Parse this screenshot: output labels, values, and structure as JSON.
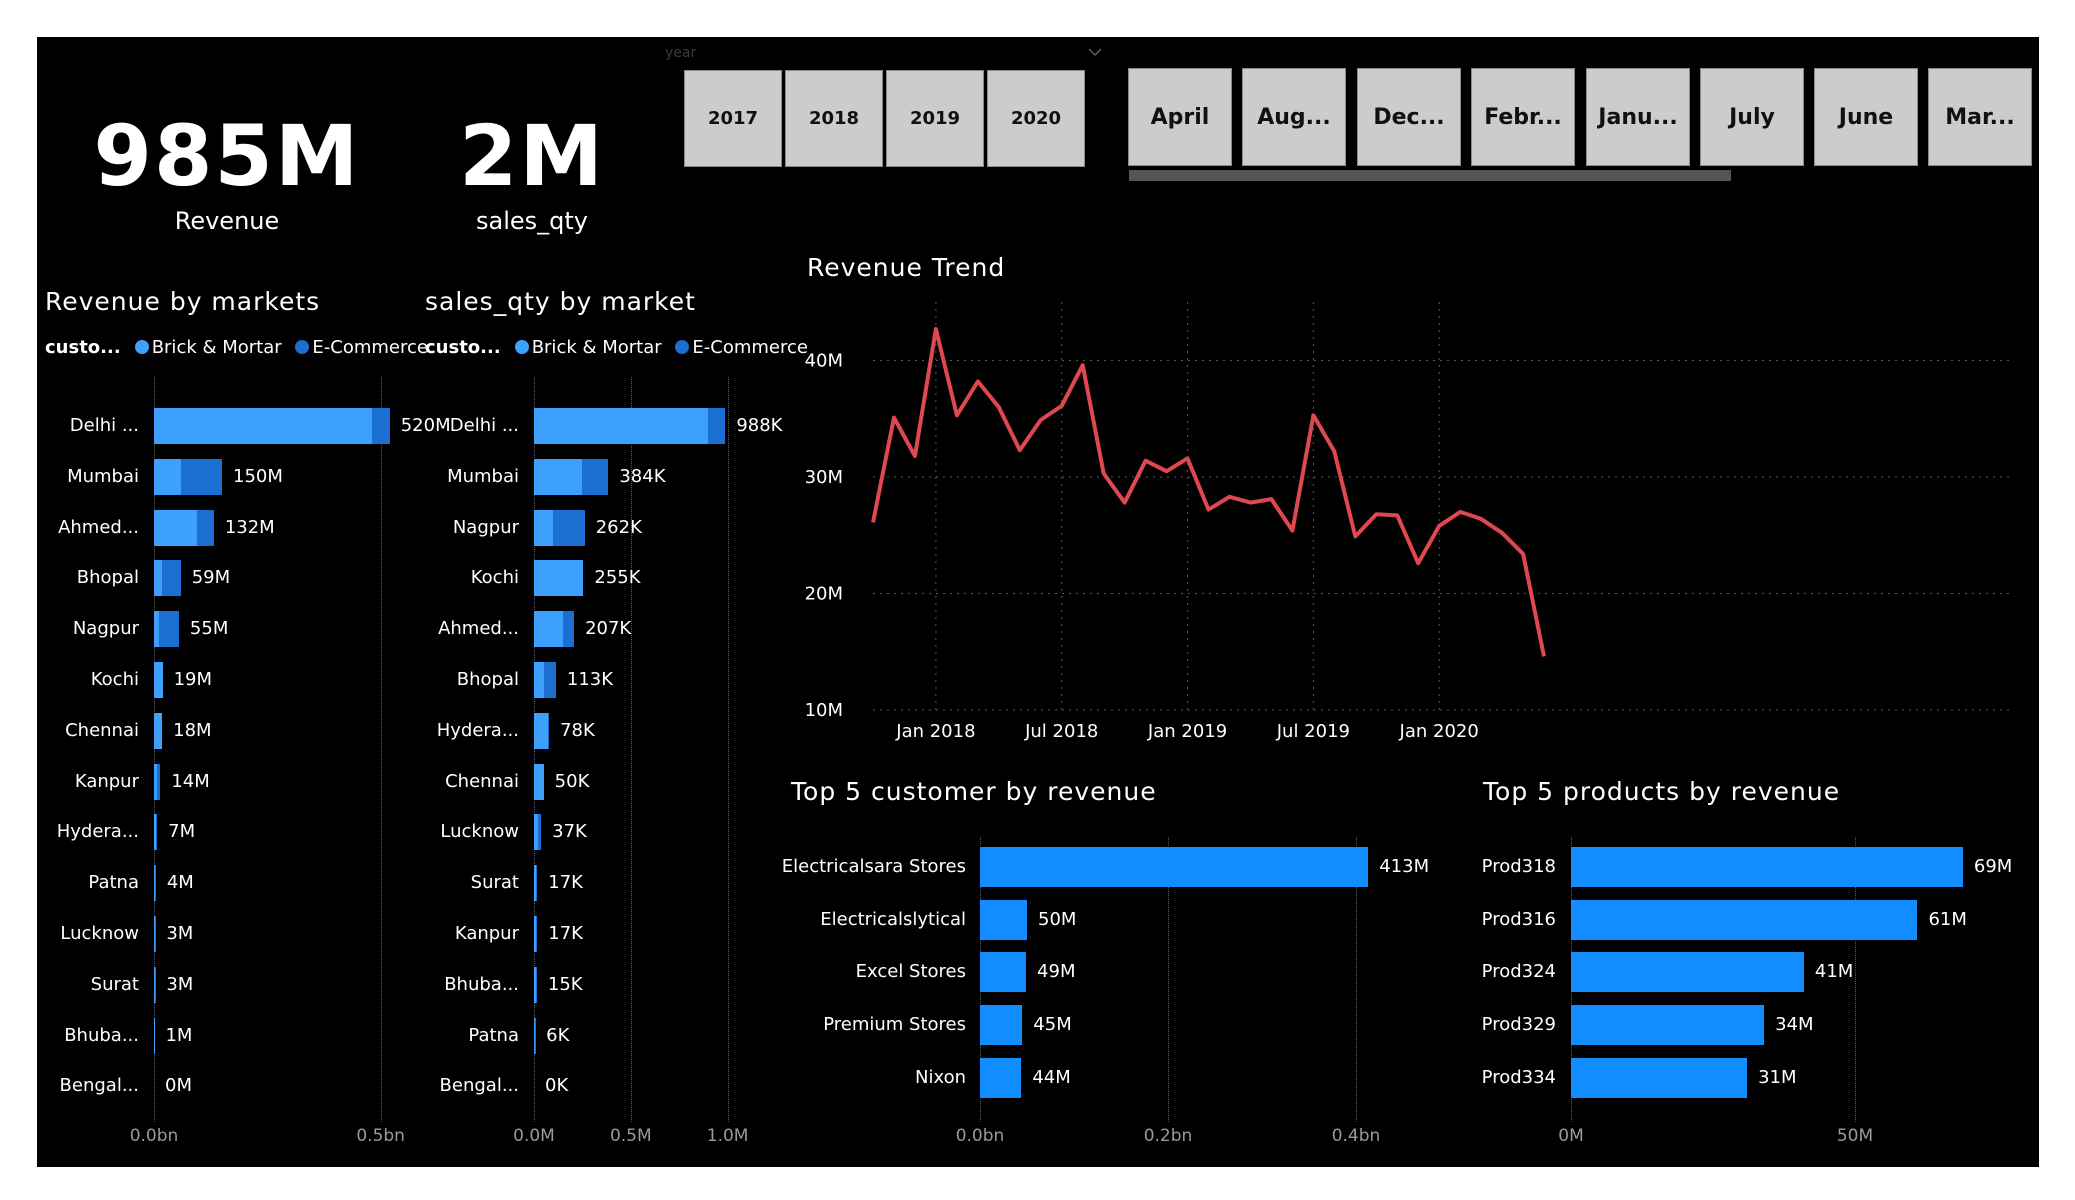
{
  "kpis": [
    {
      "value": "985M",
      "label": "Revenue"
    },
    {
      "value": "2M",
      "label": "sales_qty"
    }
  ],
  "slicers": {
    "year_label": "year",
    "years": [
      "2017",
      "2018",
      "2019",
      "2020"
    ],
    "months": [
      "April",
      "Aug...",
      "Dec...",
      "Febr...",
      "Janu...",
      "July",
      "June",
      "Mar..."
    ]
  },
  "colors": {
    "background": "#000000",
    "brick_mortar": "#3ca0ff",
    "ecommerce": "#1a6fd1",
    "bar": "#118dff",
    "trend_line": "#e04850",
    "text": "#ffffff",
    "axis_text": "#9a9a9a",
    "slicer_button": "#cccccc"
  },
  "legend": {
    "title": "custo...",
    "items": [
      "Brick & Mortar",
      "E-Commerce"
    ]
  },
  "revenue_by_markets": {
    "title": "Revenue by markets",
    "chart_data": {
      "type": "bar",
      "orientation": "horizontal",
      "stacked": true,
      "categories": [
        "Delhi ...",
        "Mumbai",
        "Ahmed...",
        "Bhopal",
        "Nagpur",
        "Kochi",
        "Chennai",
        "Kanpur",
        "Hydera...",
        "Patna",
        "Lucknow",
        "Surat",
        "Bhuba...",
        "Bengal..."
      ],
      "total_labels": [
        "520M",
        "150M",
        "132M",
        "59M",
        "55M",
        "19M",
        "18M",
        "14M",
        "7M",
        "4M",
        "3M",
        "3M",
        "1M",
        "0M"
      ],
      "series": [
        {
          "name": "Brick & Mortar",
          "values": [
            0.48,
            0.06,
            0.095,
            0.018,
            0.01,
            0.019,
            0.018,
            0.006,
            0.004,
            0.002,
            0.002,
            0.002,
            0.001,
            0.0
          ]
        },
        {
          "name": "E-Commerce",
          "values": [
            0.04,
            0.09,
            0.037,
            0.041,
            0.045,
            0.0,
            0.0,
            0.008,
            0.003,
            0.002,
            0.001,
            0.001,
            0.0,
            0.0
          ]
        }
      ],
      "xlim": [
        0,
        0.6
      ],
      "xticks": [
        {
          "v": 0,
          "label": "0.0bn"
        },
        {
          "v": 0.5,
          "label": "0.5bn"
        }
      ],
      "grid": true
    }
  },
  "sales_qty_by_market": {
    "title": "sales_qty by market",
    "chart_data": {
      "type": "bar",
      "orientation": "horizontal",
      "stacked": true,
      "categories": [
        "Delhi ...",
        "Mumbai",
        "Nagpur",
        "Kochi",
        "Ahmed...",
        "Bhopal",
        "Hydera...",
        "Chennai",
        "Lucknow",
        "Surat",
        "Kanpur",
        "Bhuba...",
        "Patna",
        "Bengal..."
      ],
      "total_labels": [
        "988K",
        "384K",
        "262K",
        "255K",
        "207K",
        "113K",
        "78K",
        "50K",
        "37K",
        "17K",
        "17K",
        "15K",
        "6K",
        "0K"
      ],
      "series": [
        {
          "name": "Brick & Mortar",
          "values": [
            0.9,
            0.25,
            0.1,
            0.255,
            0.15,
            0.05,
            0.07,
            0.05,
            0.02,
            0.01,
            0.01,
            0.01,
            0.003,
            0.0
          ]
        },
        {
          "name": "E-Commerce",
          "values": [
            0.088,
            0.134,
            0.162,
            0.0,
            0.057,
            0.063,
            0.008,
            0.0,
            0.017,
            0.007,
            0.007,
            0.005,
            0.003,
            0.0
          ]
        }
      ],
      "xlim": [
        0,
        1.1
      ],
      "xticks": [
        {
          "v": 0,
          "label": "0.0M"
        },
        {
          "v": 0.5,
          "label": "0.5M"
        },
        {
          "v": 1.0,
          "label": "1.0M"
        }
      ],
      "grid": true
    }
  },
  "revenue_trend": {
    "title": "Revenue Trend",
    "chart_data": {
      "type": "line",
      "x": [
        "2017-10",
        "2017-11",
        "2017-12",
        "2018-01",
        "2018-02",
        "2018-03",
        "2018-04",
        "2018-05",
        "2018-06",
        "2018-07",
        "2018-08",
        "2018-09",
        "2018-10",
        "2018-11",
        "2018-12",
        "2019-01",
        "2019-02",
        "2019-03",
        "2019-04",
        "2019-05",
        "2019-06",
        "2019-07",
        "2019-08",
        "2019-09",
        "2019-10",
        "2019-11",
        "2019-12",
        "2020-01",
        "2020-02",
        "2020-03",
        "2020-04",
        "2020-05",
        "2020-06"
      ],
      "y": [
        26.1,
        35.1,
        31.8,
        42.7,
        35.3,
        38.2,
        36.0,
        32.3,
        34.9,
        36.1,
        39.6,
        30.3,
        27.8,
        31.4,
        30.5,
        31.6,
        27.2,
        28.3,
        27.8,
        28.1,
        25.4,
        35.3,
        32.2,
        24.9,
        26.8,
        26.7,
        22.6,
        25.8,
        27.0,
        26.4,
        25.2,
        23.4,
        14.6
      ],
      "ylim": [
        10,
        45
      ],
      "yticks": [
        {
          "v": 10,
          "label": "10M"
        },
        {
          "v": 20,
          "label": "20M"
        },
        {
          "v": 30,
          "label": "30M"
        },
        {
          "v": 40,
          "label": "40M"
        }
      ],
      "xticks": [
        {
          "i": 3,
          "label": "Jan 2018"
        },
        {
          "i": 9,
          "label": "Jul 2018"
        },
        {
          "i": 15,
          "label": "Jan 2019"
        },
        {
          "i": 21,
          "label": "Jul 2019"
        },
        {
          "i": 27,
          "label": "Jan 2020"
        }
      ],
      "grid": true
    }
  },
  "top_customers": {
    "title": "Top 5 customer by revenue",
    "chart_data": {
      "type": "bar",
      "orientation": "horizontal",
      "categories": [
        "Electricalsara Stores",
        "Electricalslytical",
        "Excel Stores",
        "Premium Stores",
        "Nixon"
      ],
      "values": [
        0.413,
        0.05,
        0.049,
        0.045,
        0.044
      ],
      "value_labels": [
        "413M",
        "50M",
        "49M",
        "45M",
        "44M"
      ],
      "xlim": [
        0,
        0.45
      ],
      "xticks": [
        {
          "v": 0,
          "label": "0.0bn"
        },
        {
          "v": 0.2,
          "label": "0.2bn"
        },
        {
          "v": 0.4,
          "label": "0.4bn"
        }
      ],
      "grid": true
    }
  },
  "top_products": {
    "title": "Top 5 products by revenue",
    "chart_data": {
      "type": "bar",
      "orientation": "horizontal",
      "categories": [
        "Prod318",
        "Prod316",
        "Prod324",
        "Prod329",
        "Prod334"
      ],
      "values": [
        69,
        61,
        41,
        34,
        31
      ],
      "value_labels": [
        "69M",
        "61M",
        "41M",
        "34M",
        "31M"
      ],
      "xlim": [
        0,
        75
      ],
      "xticks": [
        {
          "v": 0,
          "label": "0M"
        },
        {
          "v": 50,
          "label": "50M"
        }
      ],
      "grid": true
    }
  }
}
